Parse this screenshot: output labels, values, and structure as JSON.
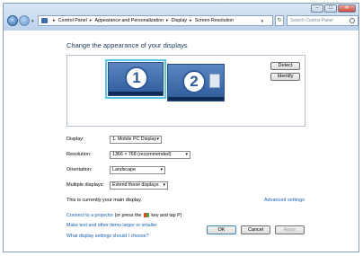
{
  "address_bar": {
    "crumbs": [
      "Control Panel",
      "Appearance and Personalization",
      "Display",
      "Screen Resolution"
    ],
    "search_placeholder": "Search Control Panel"
  },
  "heading": "Change the appearance of your displays",
  "monitors": [
    {
      "number": "1",
      "selected": true
    },
    {
      "number": "2",
      "selected": false
    }
  ],
  "buttons": {
    "detect": "Detect",
    "identify": "Identify",
    "ok": "OK",
    "cancel": "Cancel",
    "apply": "Apply"
  },
  "settings": {
    "display_label": "Display:",
    "display_value": "1. Mobile PC Display",
    "resolution_label": "Resolution:",
    "resolution_value": "1366 × 768 (recommended)",
    "orientation_label": "Orientation:",
    "orientation_value": "Landscape",
    "multiple_label": "Multiple displays:",
    "multiple_value": "Extend these displays"
  },
  "main_display_text": "This is currently your main display.",
  "advanced_link": "Advanced settings",
  "links": {
    "projector": "Connect to a projector",
    "projector_hint_pre": "(or press the",
    "projector_hint_post": "key and tap P)",
    "text_size": "Make text and other items larger or smaller",
    "which_settings": "What display settings should I choose?"
  },
  "colors": {
    "accent": "#1a5fb4",
    "heading": "#1e395b",
    "selection_outline": "#5bc4e8"
  }
}
